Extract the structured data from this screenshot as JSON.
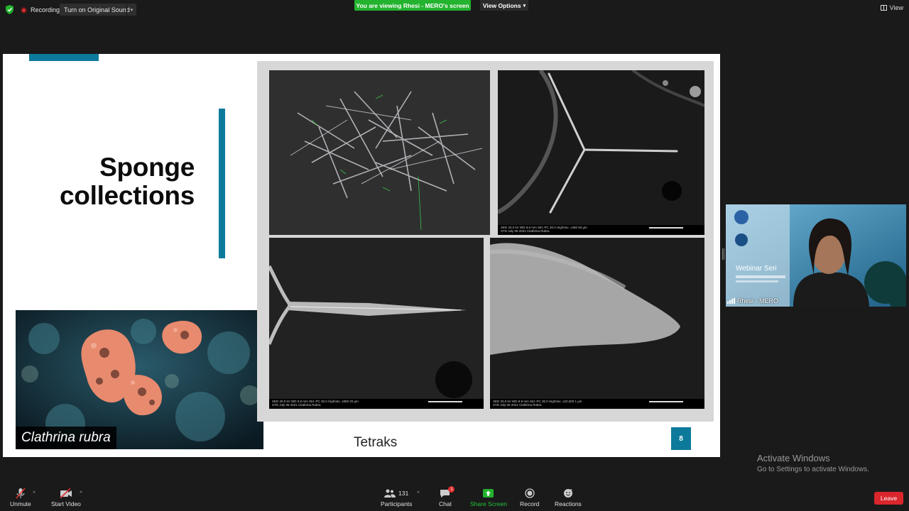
{
  "topbar": {
    "recording_label": "Recording",
    "sound_button_label": "Turn on Original Sound",
    "viewing_banner": "You are viewing Rhesi - MERO's screen",
    "view_options_label": "View Options",
    "view_label": "View"
  },
  "slide": {
    "title_line1": "Sponge",
    "title_line2": "collections",
    "species_caption": "Clathrina rubra",
    "figure_caption": "Tetraks",
    "page_number": "8",
    "accent_color": "#0e7a9b",
    "sem_images": [
      {
        "id": "sem-1",
        "label": "spicule cluster"
      },
      {
        "id": "sem-2",
        "info": "SED 20.0 kV WD 8.8 mm Std.-PC 30.0 HighVac. x450 50 µm",
        "date": "STD July 06 2021 Clathrina Rubra"
      },
      {
        "id": "sem-3",
        "info": "SED 20.0 kV WD 8.8 mm Std.-PC 30.0 HighVac. x900 20 µm",
        "date": "STD July 06 2021 Clathrina Rubra"
      },
      {
        "id": "sem-4",
        "info": "SED 20.0 kV WD 8.9 mm Std.-PC 30.0 HighVac. x22,000 1 µm",
        "date": "STD July 06 2021 Clathrina Rubra"
      }
    ]
  },
  "participant_video": {
    "name": "Rhesi - MERO",
    "background_text": "Webinar Seri"
  },
  "watermark": {
    "line1": "Activate Windows",
    "line2": "Go to Settings to activate Windows."
  },
  "toolbar": {
    "unmute": "Unmute",
    "start_video": "Start Video",
    "participants": "Participants",
    "participants_count": "131",
    "chat": "Chat",
    "chat_badge": "1",
    "share_screen": "Share Screen",
    "record": "Record",
    "reactions": "Reactions",
    "leave": "Leave"
  }
}
